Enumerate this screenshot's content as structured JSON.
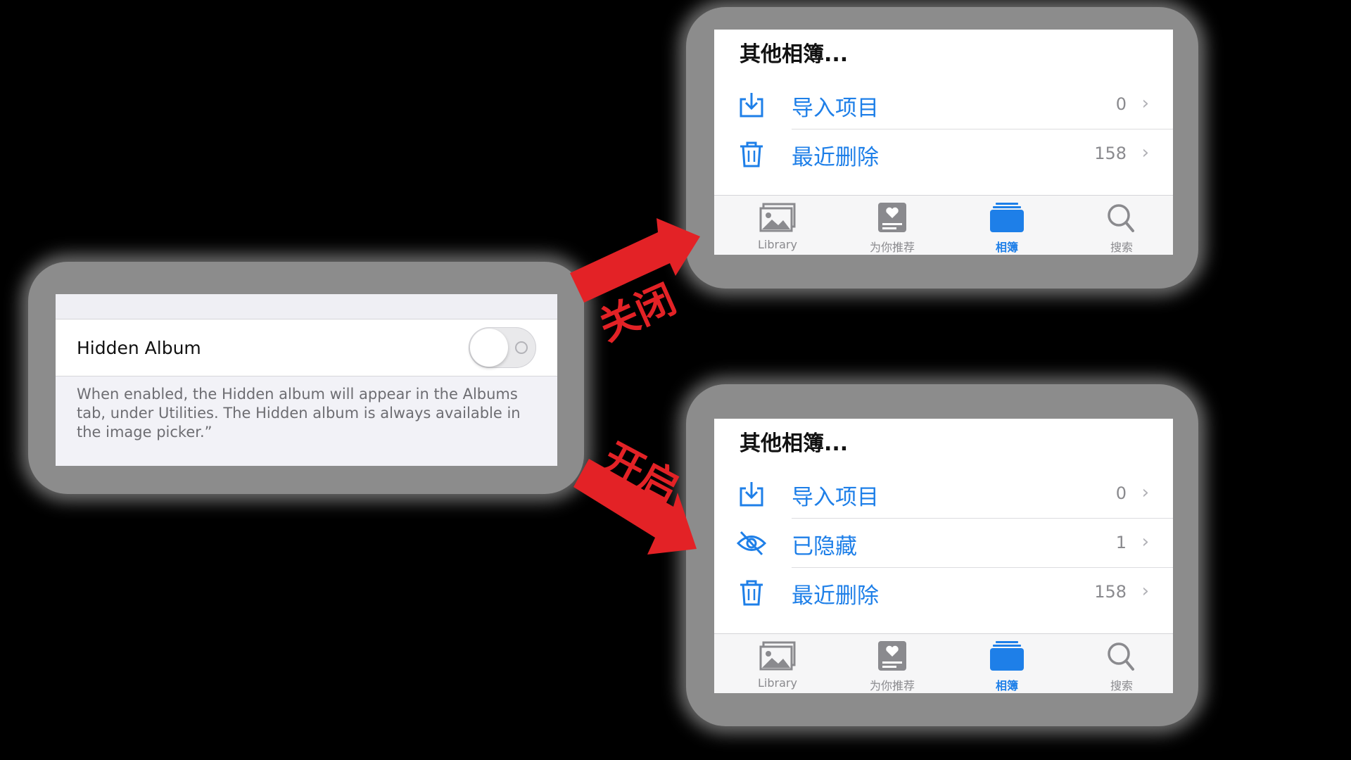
{
  "settings": {
    "hidden_album_label": "Hidden Album",
    "hidden_album_enabled": false,
    "footer_text": "When enabled, the Hidden album will appear in the Albums tab, under Utilities. The Hidden album is always available in the image picker.”"
  },
  "annotations": {
    "off_label": "关闭",
    "on_label": "开启",
    "arrow_color": "#e32226"
  },
  "photos_off": {
    "section_title": "其他相簿...",
    "items": [
      {
        "icon": "import-icon",
        "label": "导入项目",
        "count": "0",
        "chevron": "›"
      },
      {
        "icon": "trash-icon",
        "label": "最近删除",
        "count": "158",
        "chevron": "›"
      }
    ]
  },
  "photos_on": {
    "section_title": "其他相簿...",
    "items": [
      {
        "icon": "import-icon",
        "label": "导入项目",
        "count": "0",
        "chevron": "›"
      },
      {
        "icon": "hidden-eye-icon",
        "label": "已隐藏",
        "count": "1",
        "chevron": "›"
      },
      {
        "icon": "trash-icon",
        "label": "最近删除",
        "count": "158",
        "chevron": "›"
      }
    ]
  },
  "tabbar": {
    "tabs": [
      {
        "icon": "library-icon",
        "label": "Library",
        "active": false
      },
      {
        "icon": "for-you-icon",
        "label": "为你推荐",
        "active": false
      },
      {
        "icon": "albums-icon",
        "label": "相簿",
        "active": true
      },
      {
        "icon": "search-icon",
        "label": "搜索",
        "active": false
      }
    ]
  },
  "colors": {
    "accent": "#1e7fe8",
    "inactive": "#8a8a8e",
    "background": "#000000"
  }
}
